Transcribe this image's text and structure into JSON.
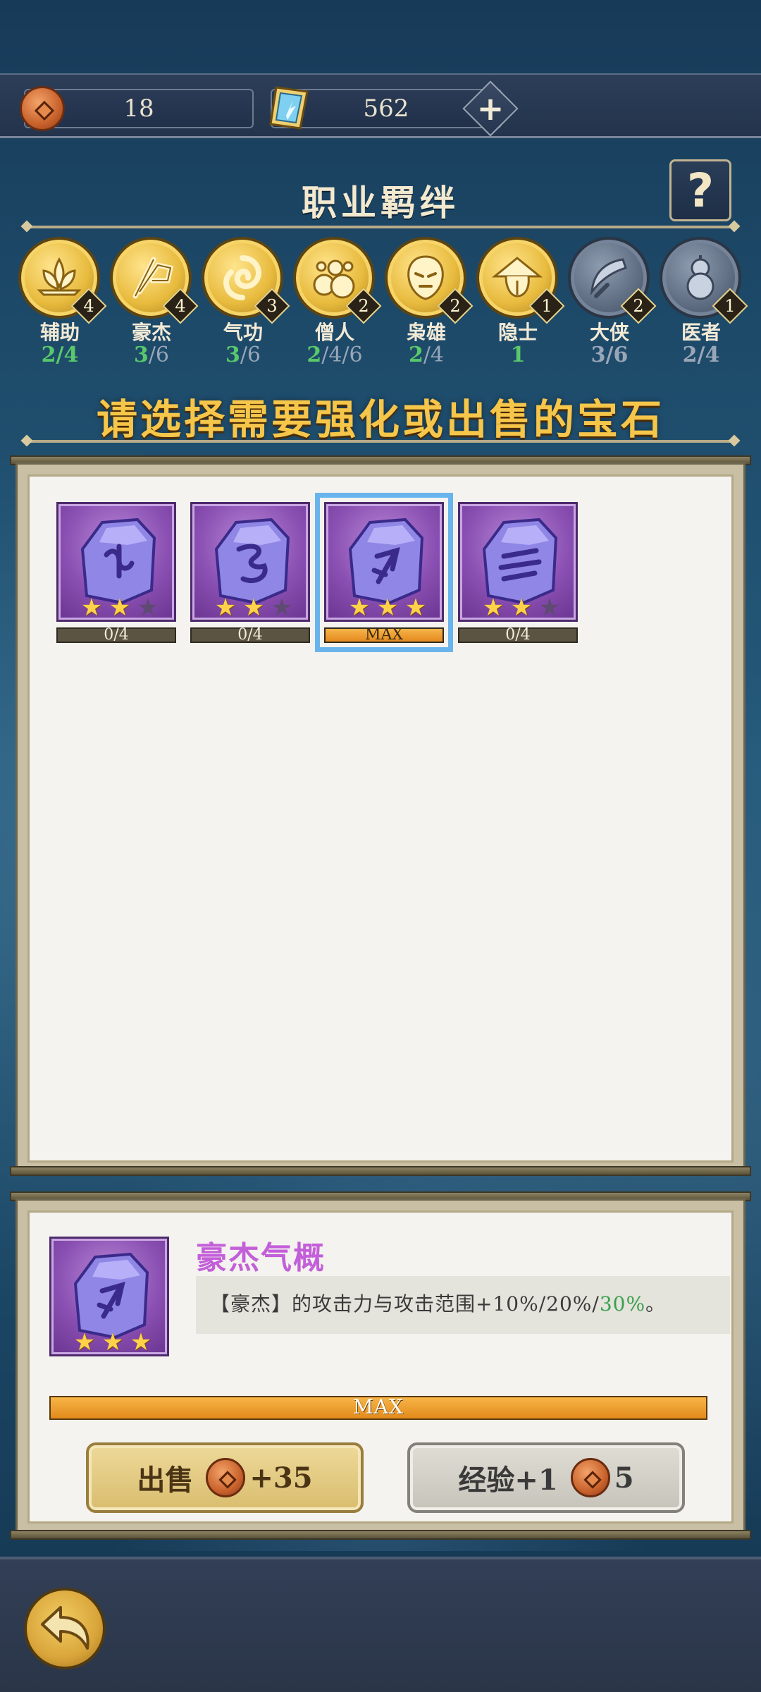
{
  "currency": {
    "coins": "18",
    "gems": "562",
    "add_label": "+"
  },
  "bonds": {
    "title": "职业羁绊",
    "help_label": "?",
    "items": [
      {
        "name": "辅助",
        "count": "4",
        "progress": "2/4",
        "active": true,
        "icon": "lotus-icon"
      },
      {
        "name": "豪杰",
        "count": "4",
        "progress": "3/6",
        "active": true,
        "icon": "banner-icon"
      },
      {
        "name": "气功",
        "count": "3",
        "progress": "3/6",
        "active": true,
        "icon": "swirl-icon"
      },
      {
        "name": "僧人",
        "count": "2",
        "progress": "2/4/6",
        "active": true,
        "icon": "beads-icon"
      },
      {
        "name": "枭雄",
        "count": "2",
        "progress": "2/4",
        "active": true,
        "icon": "mask-icon"
      },
      {
        "name": "隐士",
        "count": "1",
        "progress": "1",
        "active": true,
        "icon": "hermit-icon"
      },
      {
        "name": "大侠",
        "count": "2",
        "progress": "3/6",
        "active": false,
        "icon": "blade-icon"
      },
      {
        "name": "医者",
        "count": "1",
        "progress": "2/4",
        "active": false,
        "icon": "gourd-icon"
      }
    ]
  },
  "instruction": "请选择需要强化或出售的宝石",
  "gems": [
    {
      "stars": 2,
      "level": "0/4",
      "selected": false,
      "rune": "rune-1-icon"
    },
    {
      "stars": 2,
      "level": "0/4",
      "selected": false,
      "rune": "rune-2-icon"
    },
    {
      "stars": 3,
      "level": "MAX",
      "selected": true,
      "rune": "rune-3-icon"
    },
    {
      "stars": 2,
      "level": "0/4",
      "selected": false,
      "rune": "rune-4-icon"
    }
  ],
  "detail": {
    "name": "豪杰气概",
    "desc_prefix": "【豪杰】的攻击力与攻击范围+10%/20%/",
    "desc_highlight": "30%",
    "desc_suffix": "。",
    "stars": 3,
    "level_bar": "MAX"
  },
  "actions": {
    "sell_label": "出售",
    "sell_amount": "+35",
    "exp_label": "经验+1",
    "exp_cost": "5"
  },
  "colors": {
    "accent_gold": "#f6c64a",
    "active_green": "#59c86a",
    "gem_purple": "#8a4fb2",
    "detail_name": "#c35fd9",
    "selected_outline": "#6ab4ee"
  }
}
